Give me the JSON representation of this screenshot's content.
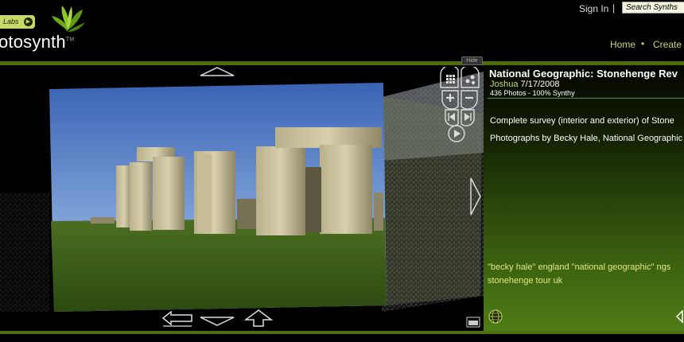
{
  "header": {
    "labs_label": "Labs",
    "brand_text": "otosynth",
    "brand_prefix": "h",
    "trademark": "TM",
    "signin": "Sign In",
    "separator": "|",
    "search_placeholder": "Search Synths",
    "nav": {
      "home": "Home",
      "dot": "•",
      "create": "Create"
    }
  },
  "viewer": {
    "hide_label": "Hide"
  },
  "synth": {
    "title": "National Geographic: Stonehenge Rev",
    "author": "Joshua",
    "date": "7/17/2008",
    "stats": "436 Photos - 100% Synthy",
    "description_1": "Complete survey (interior and exterior) of Stone",
    "description_2": "Photographs by Becky Hale, National Geographic",
    "tags_1": "\"becky hale\" england \"national geographic\" ngs",
    "tags_2": "stonehenge tour uk"
  },
  "colors": {
    "accent_green": "#c9d86a",
    "bar_green": "#4c6e0c"
  },
  "icons": [
    "grid-icon",
    "3d-view-icon",
    "zoom-in-icon",
    "zoom-out-icon",
    "previous-icon",
    "next-icon",
    "play-icon",
    "up-arrow-icon",
    "down-arrow-icon",
    "step-back-icon",
    "step-forward-icon",
    "right-arrow-icon",
    "overlay-toggle-icon",
    "globe-icon",
    "chevron-right-icon"
  ]
}
